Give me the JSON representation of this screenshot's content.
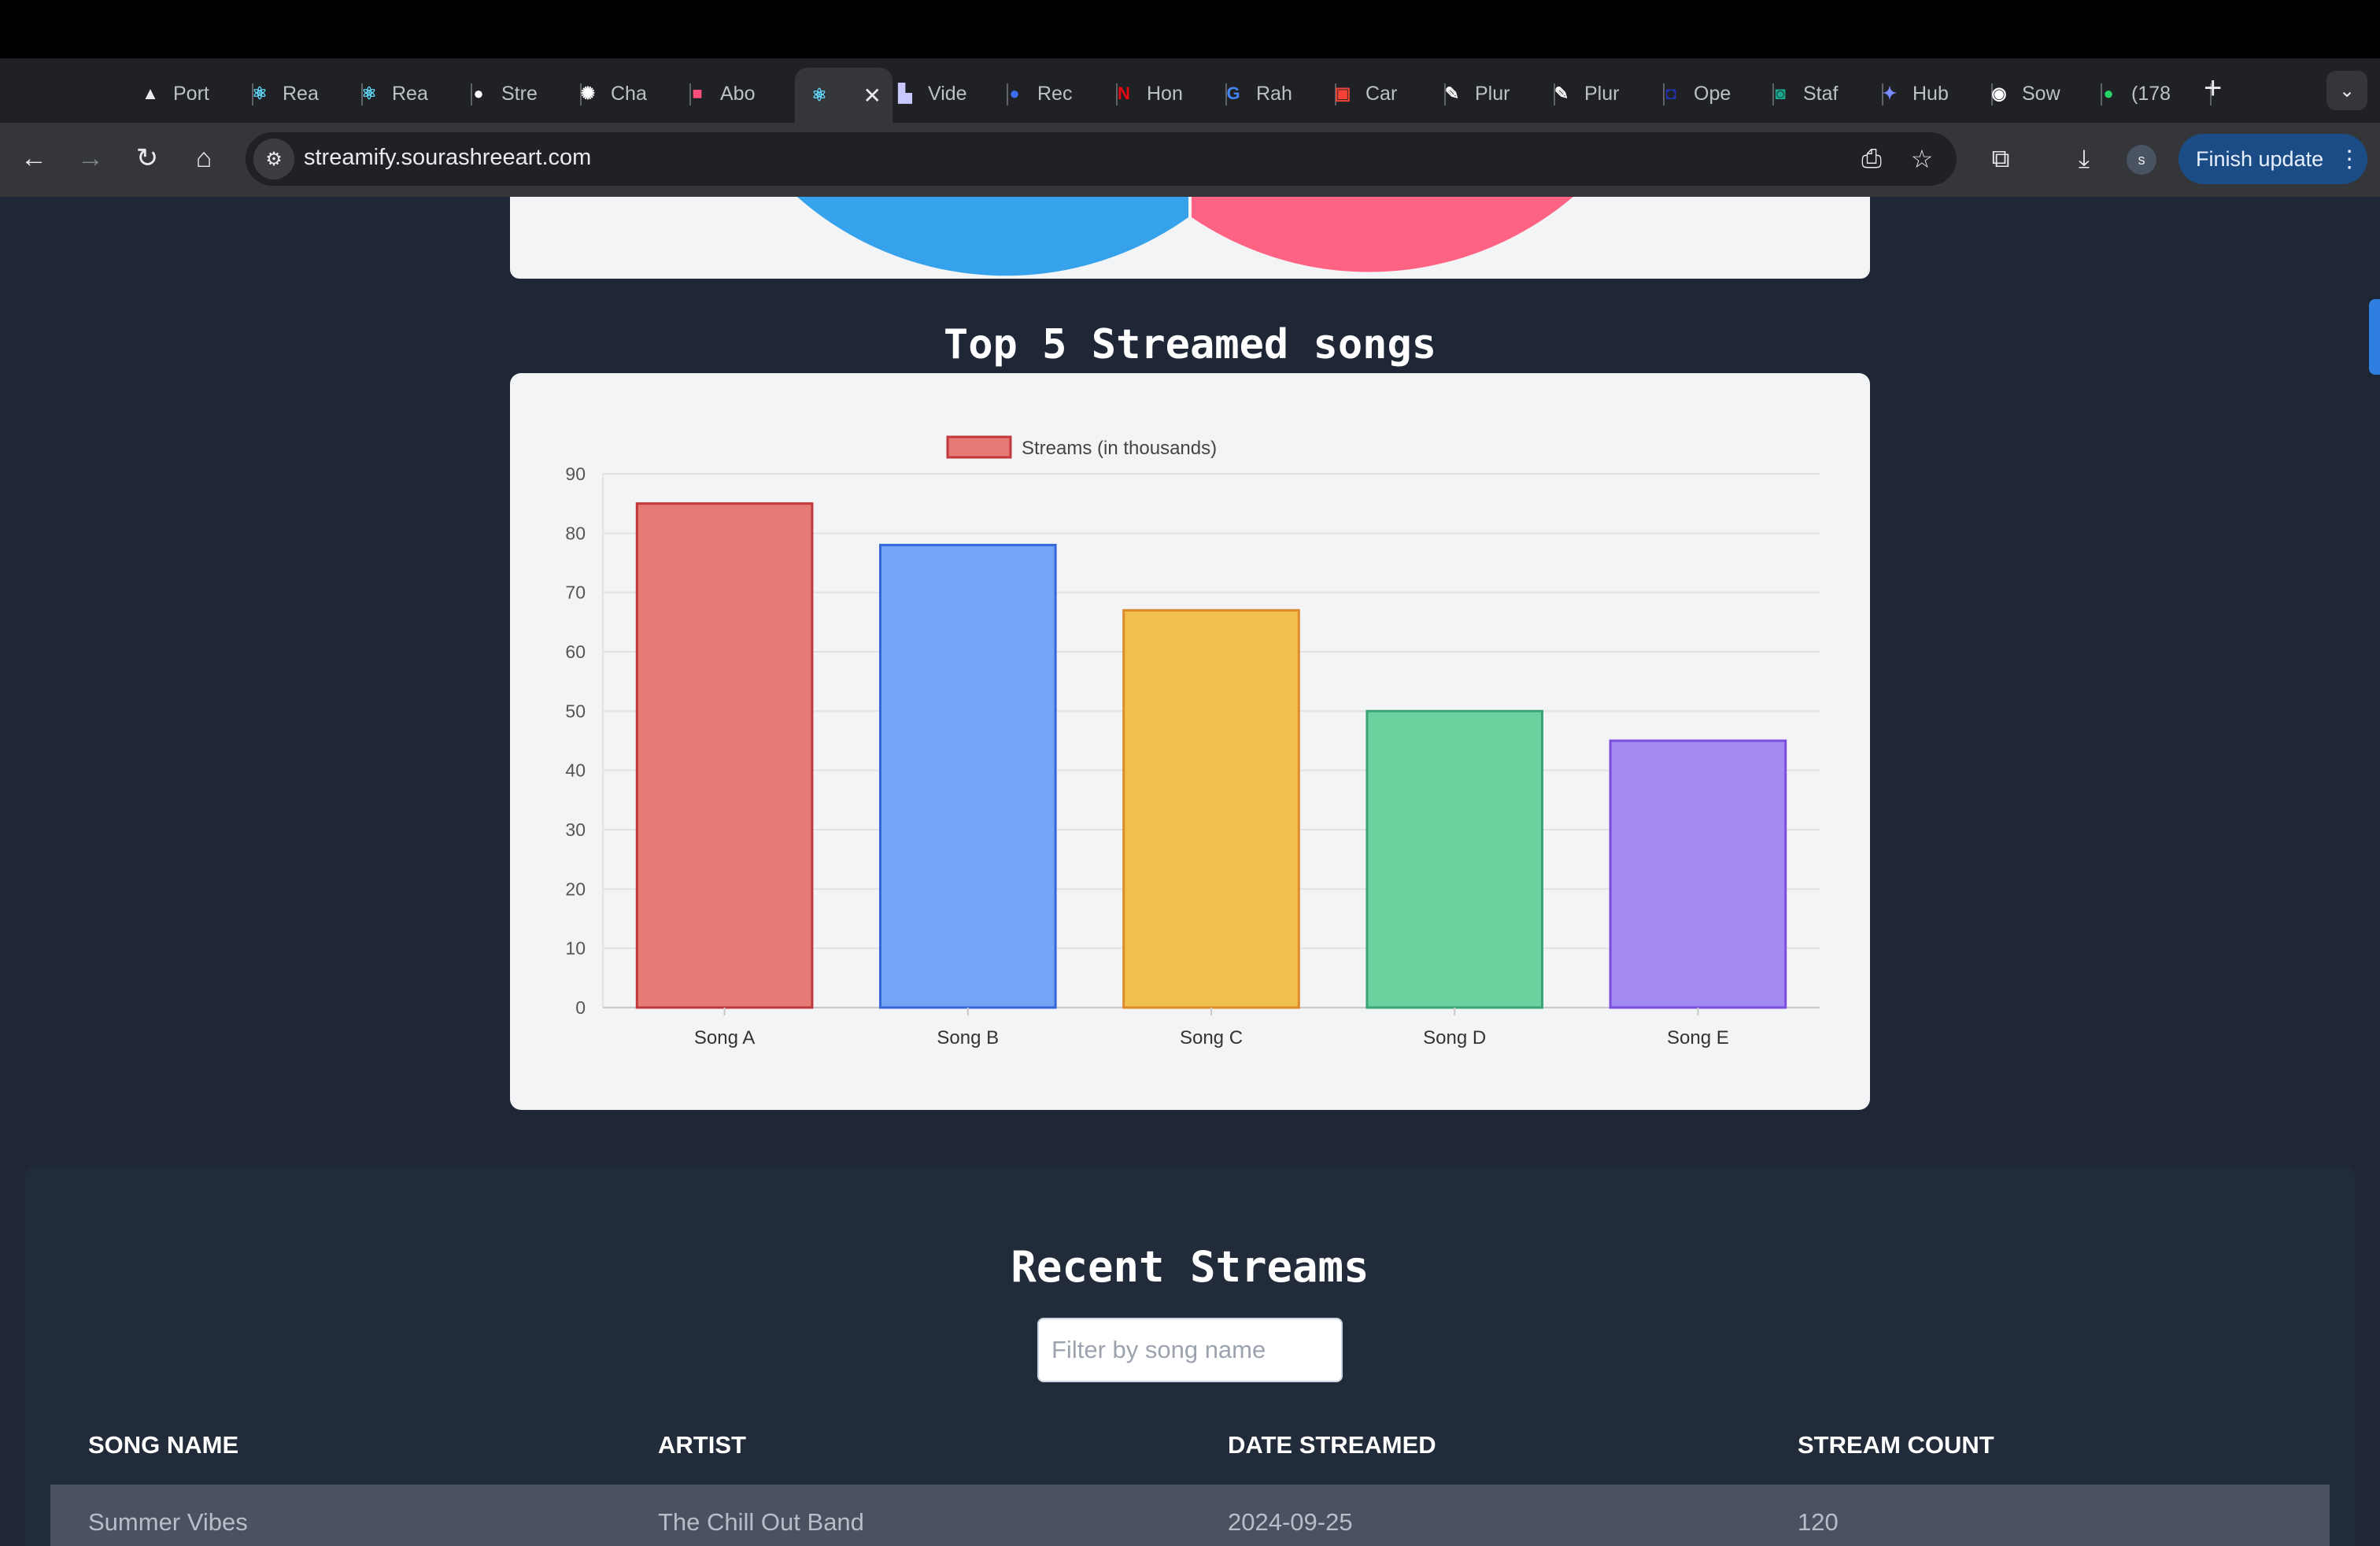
{
  "browser": {
    "tabs": [
      {
        "label": "Port",
        "icon": "vercel-icon",
        "glyph": "▲",
        "color": "#e8eaed"
      },
      {
        "label": "Rea",
        "icon": "react-icon",
        "glyph": "⚛",
        "color": "#61dafb"
      },
      {
        "label": "Rea",
        "icon": "react-icon",
        "glyph": "⚛",
        "color": "#61dafb"
      },
      {
        "label": "Stre",
        "icon": "github-icon",
        "glyph": "●",
        "color": "#ffffff"
      },
      {
        "label": "Cha",
        "icon": "chatgpt-icon",
        "glyph": "✺",
        "color": "#ffffff"
      },
      {
        "label": "Abo",
        "icon": "pink-square-icon",
        "glyph": "■",
        "color": "#ff4f7a"
      },
      {
        "label": "",
        "icon": "react-icon",
        "glyph": "⚛",
        "color": "#61dafb",
        "active": true
      },
      {
        "label": "Vide",
        "icon": "video-icon",
        "glyph": "▙",
        "color": "#c8c8ff"
      },
      {
        "label": "Rec",
        "icon": "blue-circle-icon",
        "glyph": "●",
        "color": "#3b6df0"
      },
      {
        "label": "Hon",
        "icon": "netflix-icon",
        "glyph": "N",
        "color": "#e50914"
      },
      {
        "label": "Rah",
        "icon": "google-icon",
        "glyph": "G",
        "color": "#4285f4"
      },
      {
        "label": "Car",
        "icon": "pw-icon",
        "glyph": "▣",
        "color": "#f44336"
      },
      {
        "label": "Plur",
        "icon": "pen-icon",
        "glyph": "✎",
        "color": "#ffffff"
      },
      {
        "label": "Plur",
        "icon": "pen-icon",
        "glyph": "✎",
        "color": "#ffffff"
      },
      {
        "label": "Ope",
        "icon": "open-icon",
        "glyph": "◘",
        "color": "#2233aa"
      },
      {
        "label": "Staf",
        "icon": "staff-icon",
        "glyph": "◙",
        "color": "#1aa88f"
      },
      {
        "label": "Hub",
        "icon": "sparkle-icon",
        "glyph": "✦",
        "color": "#7b8cff"
      },
      {
        "label": "Sow",
        "icon": "sow-icon",
        "glyph": "◉",
        "color": "#ffffff"
      },
      {
        "label": "(178",
        "icon": "whatsapp-icon",
        "glyph": "●",
        "color": "#25d366"
      }
    ],
    "url": "streamify.sourashreeart.com",
    "finish_update": "Finish update",
    "avatar_letter": "s"
  },
  "chart_heading": "Top 5 Streamed songs",
  "chart_data": {
    "type": "bar",
    "categories": [
      "Song A",
      "Song B",
      "Song C",
      "Song D",
      "Song E"
    ],
    "series": [
      {
        "name": "Streams (in thousands)",
        "values": [
          85,
          78,
          67,
          50,
          45
        ]
      }
    ],
    "ylim": [
      0,
      90
    ],
    "yticks": [
      0,
      10,
      20,
      30,
      40,
      50,
      60,
      70,
      80,
      90
    ],
    "legend": "top",
    "grid": true,
    "colors": {
      "fills": [
        "#e67a75",
        "#73a4f5",
        "#f1c04d",
        "#6bd29f",
        "#a38af2"
      ],
      "borders": [
        "#c0393a",
        "#3567d8",
        "#dd8a2a",
        "#3aa576",
        "#7b4ddb"
      ]
    }
  },
  "recent": {
    "title": "Recent Streams",
    "filter_placeholder": "Filter by song name",
    "columns": [
      "SONG NAME",
      "ARTIST",
      "DATE STREAMED",
      "STREAM COUNT"
    ],
    "rows": [
      [
        "Summer Vibes",
        "The Chill Out Band",
        "2024-09-25",
        "120"
      ]
    ]
  }
}
